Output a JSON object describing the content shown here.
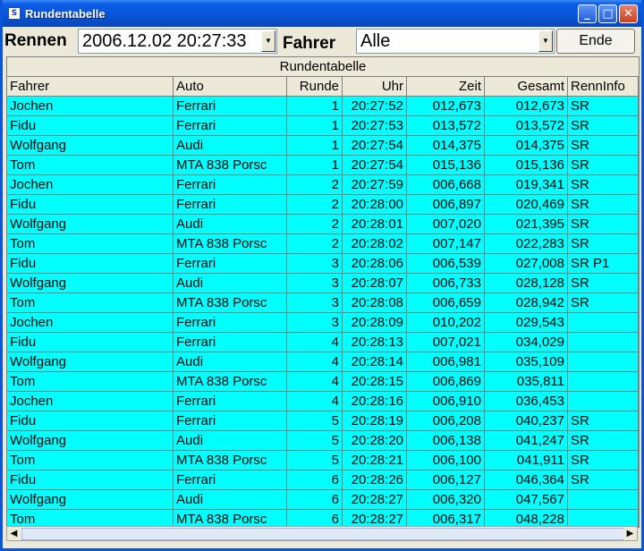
{
  "window": {
    "title": "Rundentabelle"
  },
  "toolbar": {
    "rennen_label": "Rennen",
    "rennen_value": "2006.12.02 20:27:33",
    "fahrer_label": "Fahrer",
    "fahrer_value": "Alle",
    "ende_label": "Ende"
  },
  "table": {
    "caption": "Rundentabelle",
    "columns": [
      "Fahrer",
      "Auto",
      "Runde",
      "Uhr",
      "Zeit",
      "Gesamt",
      "RennInfo"
    ],
    "rows": [
      [
        "Jochen",
        "Ferrari",
        "1",
        "20:27:52",
        "012,673",
        "012,673",
        "SR"
      ],
      [
        "Fidu",
        "Ferrari",
        "1",
        "20:27:53",
        "013,572",
        "013,572",
        "SR"
      ],
      [
        "Wolfgang",
        "Audi",
        "1",
        "20:27:54",
        "014,375",
        "014,375",
        "SR"
      ],
      [
        "Tom",
        "MTA 838 Porsc",
        "1",
        "20:27:54",
        "015,136",
        "015,136",
        "SR"
      ],
      [
        "Jochen",
        "Ferrari",
        "2",
        "20:27:59",
        "006,668",
        "019,341",
        "SR"
      ],
      [
        "Fidu",
        "Ferrari",
        "2",
        "20:28:00",
        "006,897",
        "020,469",
        "SR"
      ],
      [
        "Wolfgang",
        "Audi",
        "2",
        "20:28:01",
        "007,020",
        "021,395",
        "SR"
      ],
      [
        "Tom",
        "MTA 838 Porsc",
        "2",
        "20:28:02",
        "007,147",
        "022,283",
        "SR"
      ],
      [
        "Fidu",
        "Ferrari",
        "3",
        "20:28:06",
        "006,539",
        "027,008",
        "SR  P1"
      ],
      [
        "Wolfgang",
        "Audi",
        "3",
        "20:28:07",
        "006,733",
        "028,128",
        "SR"
      ],
      [
        "Tom",
        "MTA 838 Porsc",
        "3",
        "20:28:08",
        "006,659",
        "028,942",
        "SR"
      ],
      [
        "Jochen",
        "Ferrari",
        "3",
        "20:28:09",
        "010,202",
        "029,543",
        ""
      ],
      [
        "Fidu",
        "Ferrari",
        "4",
        "20:28:13",
        "007,021",
        "034,029",
        ""
      ],
      [
        "Wolfgang",
        "Audi",
        "4",
        "20:28:14",
        "006,981",
        "035,109",
        ""
      ],
      [
        "Tom",
        "MTA 838 Porsc",
        "4",
        "20:28:15",
        "006,869",
        "035,811",
        ""
      ],
      [
        "Jochen",
        "Ferrari",
        "4",
        "20:28:16",
        "006,910",
        "036,453",
        ""
      ],
      [
        "Fidu",
        "Ferrari",
        "5",
        "20:28:19",
        "006,208",
        "040,237",
        "SR"
      ],
      [
        "Wolfgang",
        "Audi",
        "5",
        "20:28:20",
        "006,138",
        "041,247",
        "SR"
      ],
      [
        "Tom",
        "MTA 838 Porsc",
        "5",
        "20:28:21",
        "006,100",
        "041,911",
        "SR"
      ],
      [
        "Fidu",
        "Ferrari",
        "6",
        "20:28:26",
        "006,127",
        "046,364",
        "SR"
      ],
      [
        "Wolfgang",
        "Audi",
        "6",
        "20:28:27",
        "006,320",
        "047,567",
        ""
      ],
      [
        "Tom",
        "MTA 838 Porsc",
        "6",
        "20:28:27",
        "006,317",
        "048,228",
        ""
      ]
    ]
  },
  "colors": {
    "row_bg": "#00ffff",
    "titlebar": "#0a5ee8"
  },
  "icons": [
    "app-icon",
    "minimize-icon",
    "maximize-icon",
    "close-icon",
    "dropdown-arrow-icon",
    "scroll-left-icon",
    "scroll-right-icon"
  ]
}
